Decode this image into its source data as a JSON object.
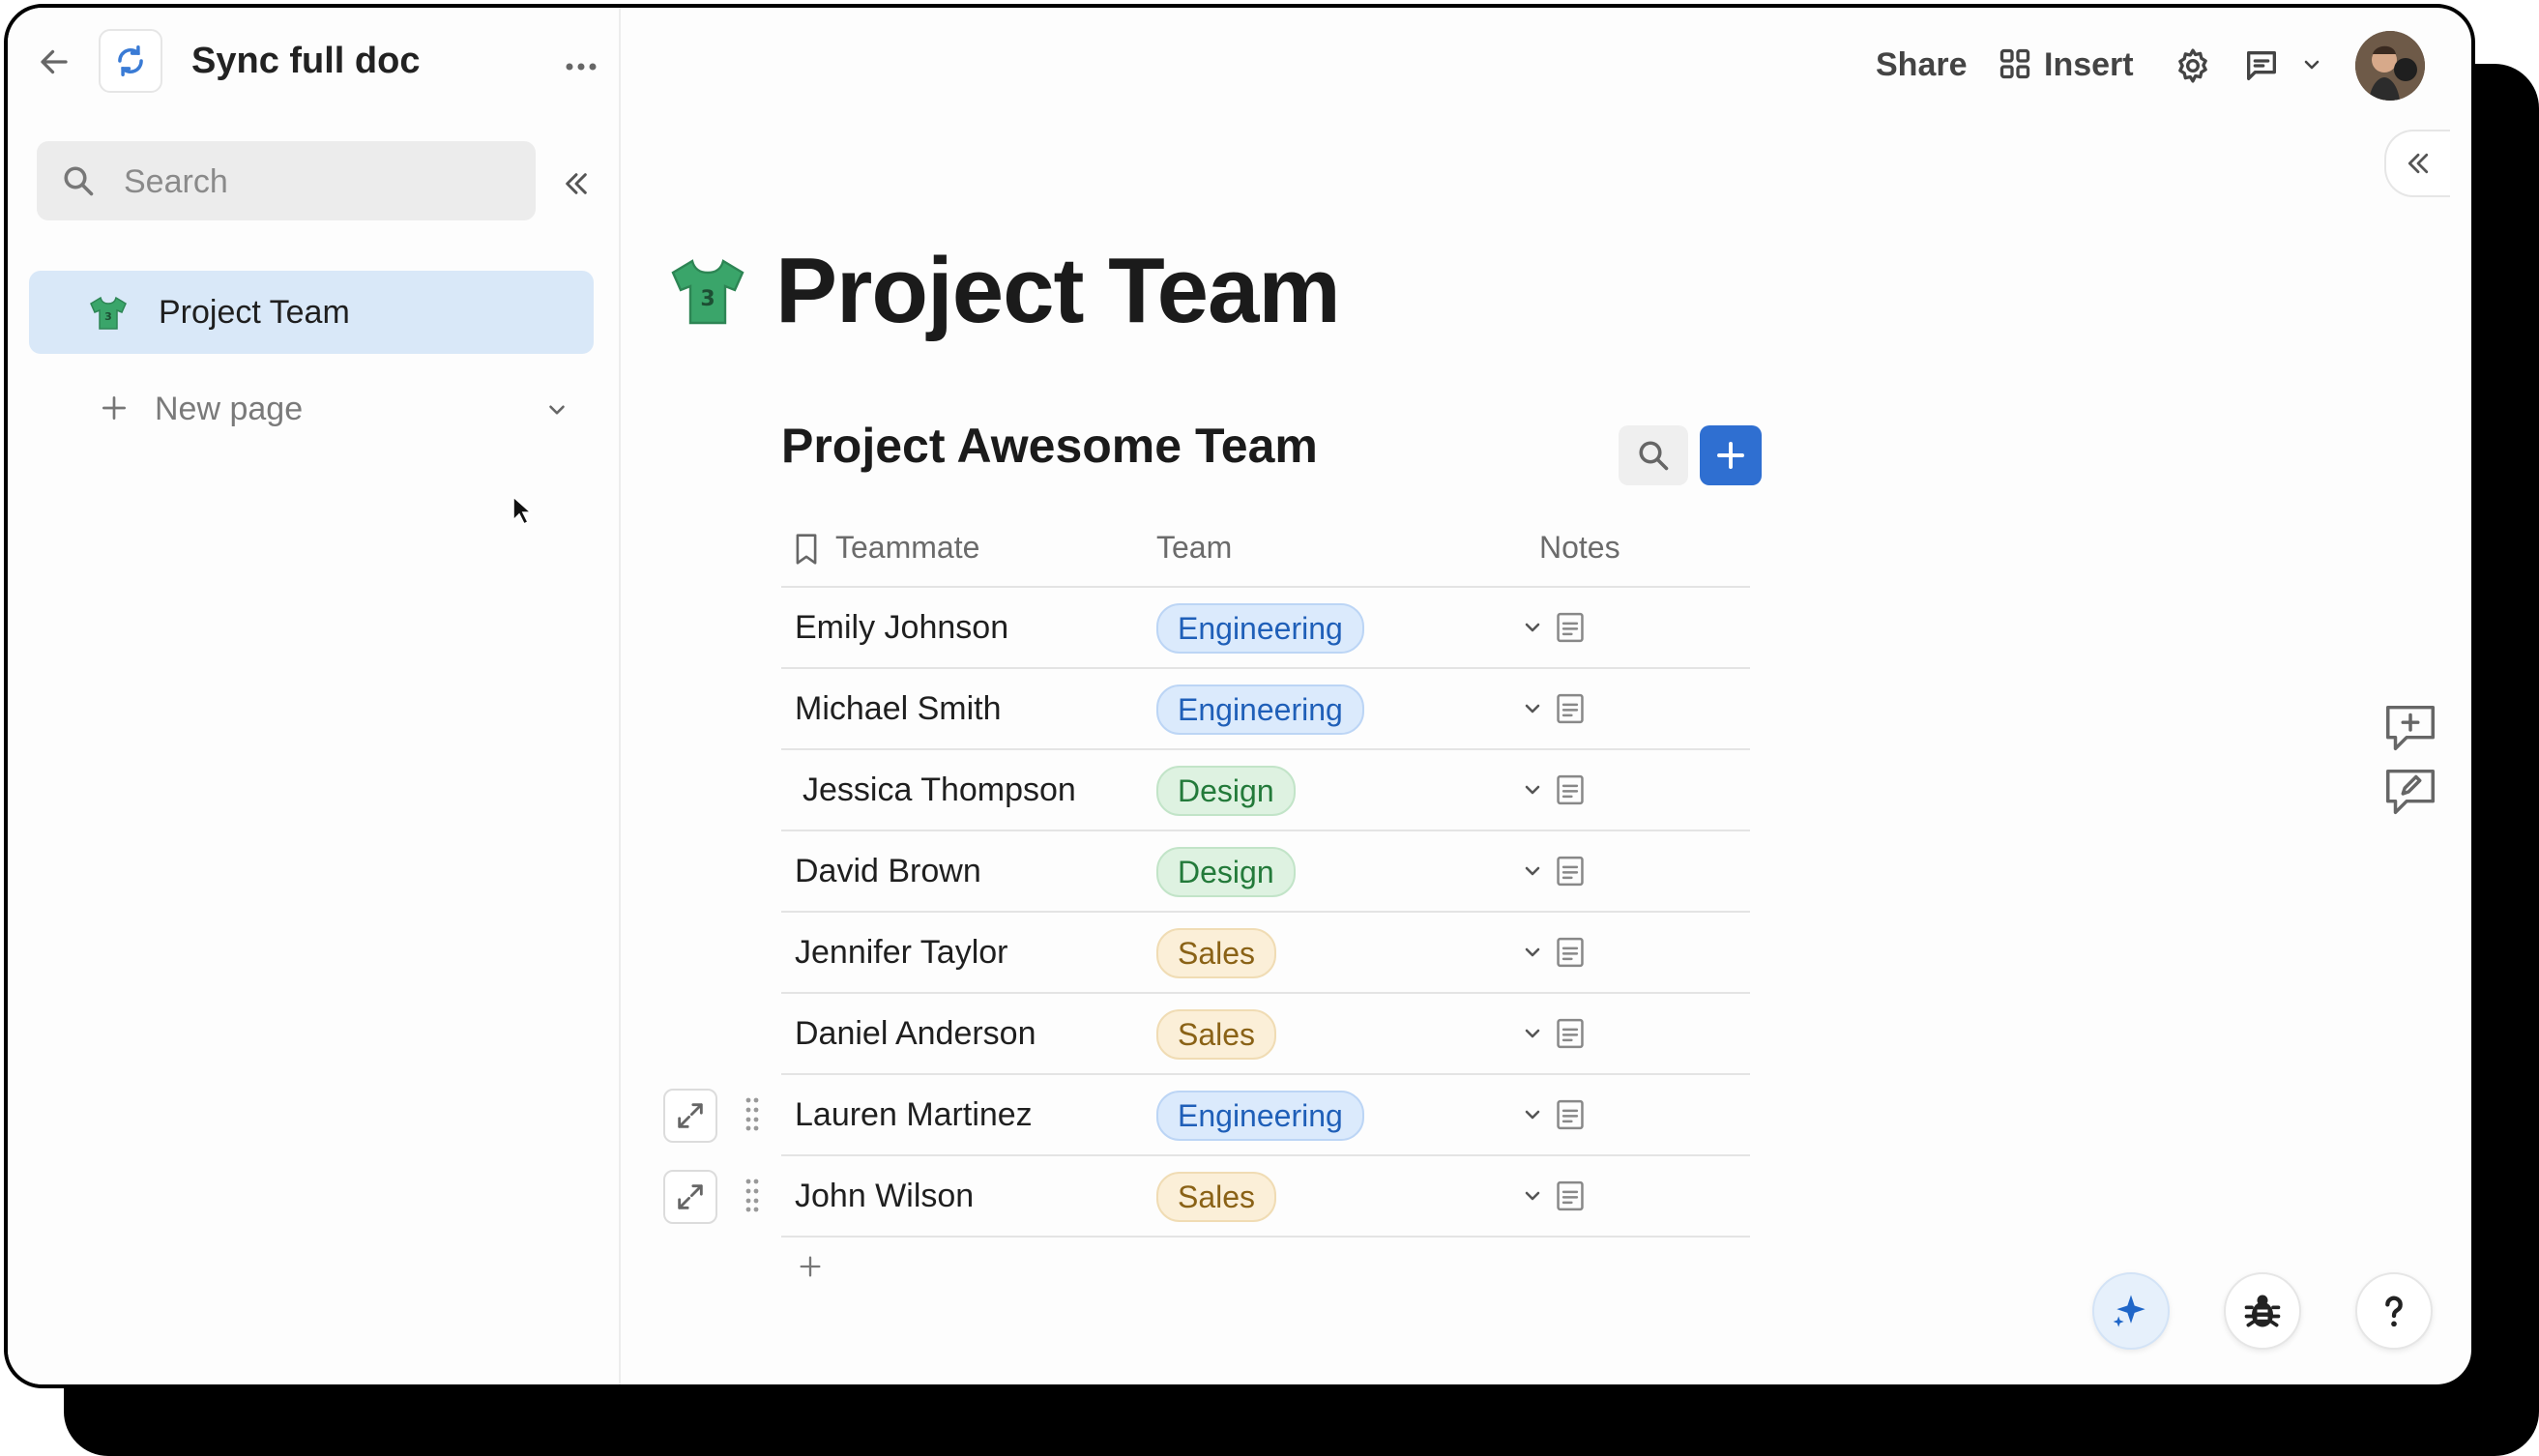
{
  "app": {
    "doc_title": "Sync full doc",
    "search_placeholder": "Search"
  },
  "sidebar": {
    "pages": [
      {
        "label": "Project Team",
        "active": true
      }
    ],
    "new_page_label": "New page"
  },
  "toolbar": {
    "share_label": "Share",
    "insert_label": "Insert"
  },
  "page": {
    "title": "Project Team"
  },
  "table": {
    "title": "Project Awesome Team",
    "columns": [
      "Teammate",
      "Team",
      "Notes"
    ],
    "rows": [
      {
        "name": "Emily Johnson",
        "team": "Engineering"
      },
      {
        "name": "Michael Smith",
        "team": "Engineering"
      },
      {
        "name": "Jessica Thompson",
        "team": "Design"
      },
      {
        "name": "David Brown",
        "team": "Design"
      },
      {
        "name": "Jennifer Taylor",
        "team": "Sales"
      },
      {
        "name": "Daniel Anderson",
        "team": "Sales"
      },
      {
        "name": "Lauren Martinez",
        "team": "Engineering"
      },
      {
        "name": "John Wilson",
        "team": "Sales"
      }
    ]
  },
  "colors": {
    "accent": "#2f6fd1",
    "active_page_bg": "#d9e8f8",
    "engineering": "#1f5fb8",
    "design": "#237a3a",
    "sales": "#8a6216"
  },
  "icons": {
    "back": "arrow-left-icon",
    "doc_logo": "sync-icon",
    "more": "more-horizontal-icon",
    "search": "search-icon",
    "collapse": "double-chevron-left-icon",
    "page": "jersey-icon",
    "insert": "grid-icon",
    "settings": "gear-icon",
    "comments": "comment-icon",
    "ai": "sparkle-icon",
    "debug": "bug-icon",
    "help": "question-icon"
  }
}
